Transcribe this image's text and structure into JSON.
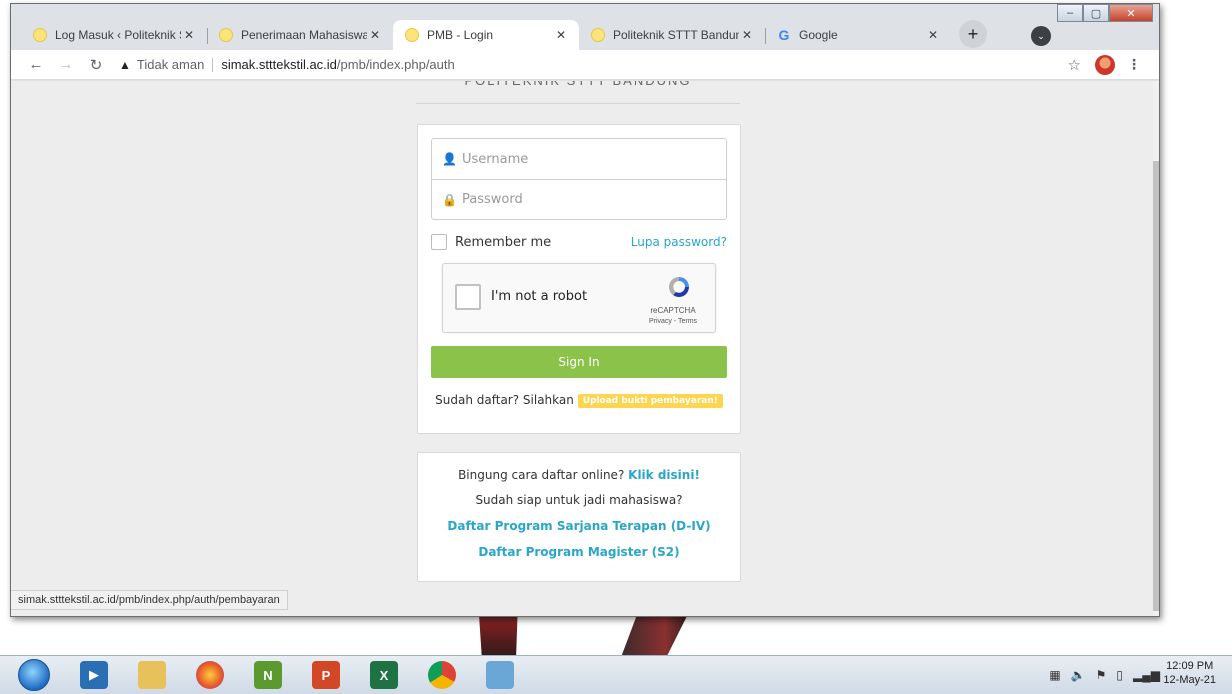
{
  "browser": {
    "tabs": [
      {
        "title": "Log Masuk ‹ Politeknik STT",
        "active": false,
        "favicon": "warning-favicon"
      },
      {
        "title": "Penerimaan Mahasiswa Ba",
        "active": false,
        "favicon": "warning-favicon"
      },
      {
        "title": "PMB - Login",
        "active": true,
        "favicon": "warning-favicon"
      },
      {
        "title": "Politeknik STTT Bandung",
        "active": false,
        "favicon": "warning-favicon"
      },
      {
        "title": "Google",
        "active": false,
        "favicon": "google-favicon"
      }
    ],
    "security_label": "Tidak aman",
    "url_host": "simak.stttekstil.ac.id",
    "url_path": "/pmb/index.php/auth",
    "status_url": "simak.stttekstil.ac.id/pmb/index.php/auth/pembayaran"
  },
  "page": {
    "header_text": "POLITEKNIK STTT BANDUNG",
    "login": {
      "username_placeholder": "Username",
      "password_placeholder": "Password",
      "remember_label": "Remember me",
      "forgot_label": "Lupa password?",
      "captcha_label": "I'm not a robot",
      "captcha_brand": "reCAPTCHA",
      "captcha_terms": "Privacy - Terms",
      "signin_label": "Sign In",
      "already_text": "Sudah daftar? Silahkan",
      "upload_badge": "Upload bukti pembayaran!"
    },
    "help": {
      "confused_text": "Bingung cara daftar online?",
      "click_here": "Klik disini!",
      "ready_text": "Sudah siap untuk jadi mahasiswa?",
      "link_d4": "Daftar Program Sarjana Terapan (D-IV)",
      "link_s2": "Daftar Program Magister (S2)"
    }
  },
  "taskbar": {
    "time": "12:09 PM",
    "date": "12-May-21"
  },
  "colors": {
    "signin_green": "#8bc34a",
    "link_blue": "#2aa6c9",
    "badge_yellow": "#ffd54f"
  }
}
